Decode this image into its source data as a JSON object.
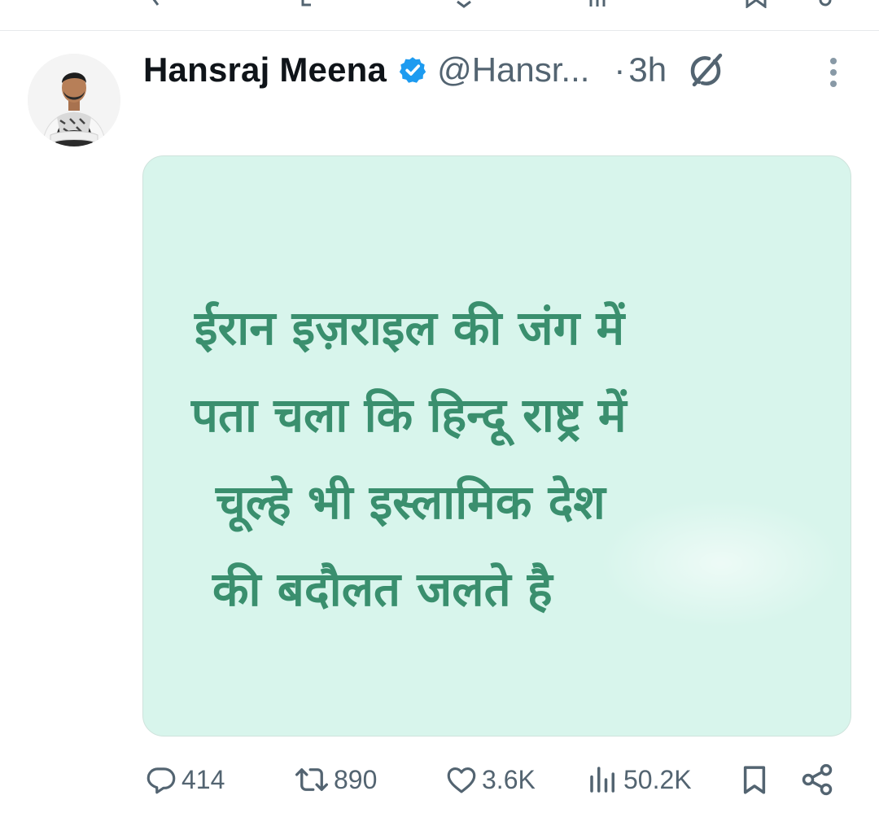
{
  "tweet": {
    "author": {
      "display_name": "Hansraj Meena",
      "handle": "@Hansr...",
      "verified": true
    },
    "separator": "·",
    "time": "3h",
    "media_text": [
      "ईरान इज़राइल की जंग में",
      "पता चला कि हिन्दू राष्ट्र में",
      "चूल्हे भी इस्लामिक देश",
      "की बदौलत जलते है"
    ],
    "actions": {
      "replies": "414",
      "reposts": "890",
      "likes": "3.6K",
      "views": "50.2K"
    }
  },
  "icons": [
    "reply-icon",
    "repost-icon",
    "like-icon",
    "views-icon",
    "bookmark-icon",
    "share-icon",
    "grok-icon",
    "more-icon",
    "verified-badge-icon"
  ],
  "colors": {
    "text": "#0f1419",
    "secondary": "#536471",
    "verified": "#1d9bf0",
    "media_bg": "#d8f5ec",
    "media_text": "#3a8f6e"
  }
}
